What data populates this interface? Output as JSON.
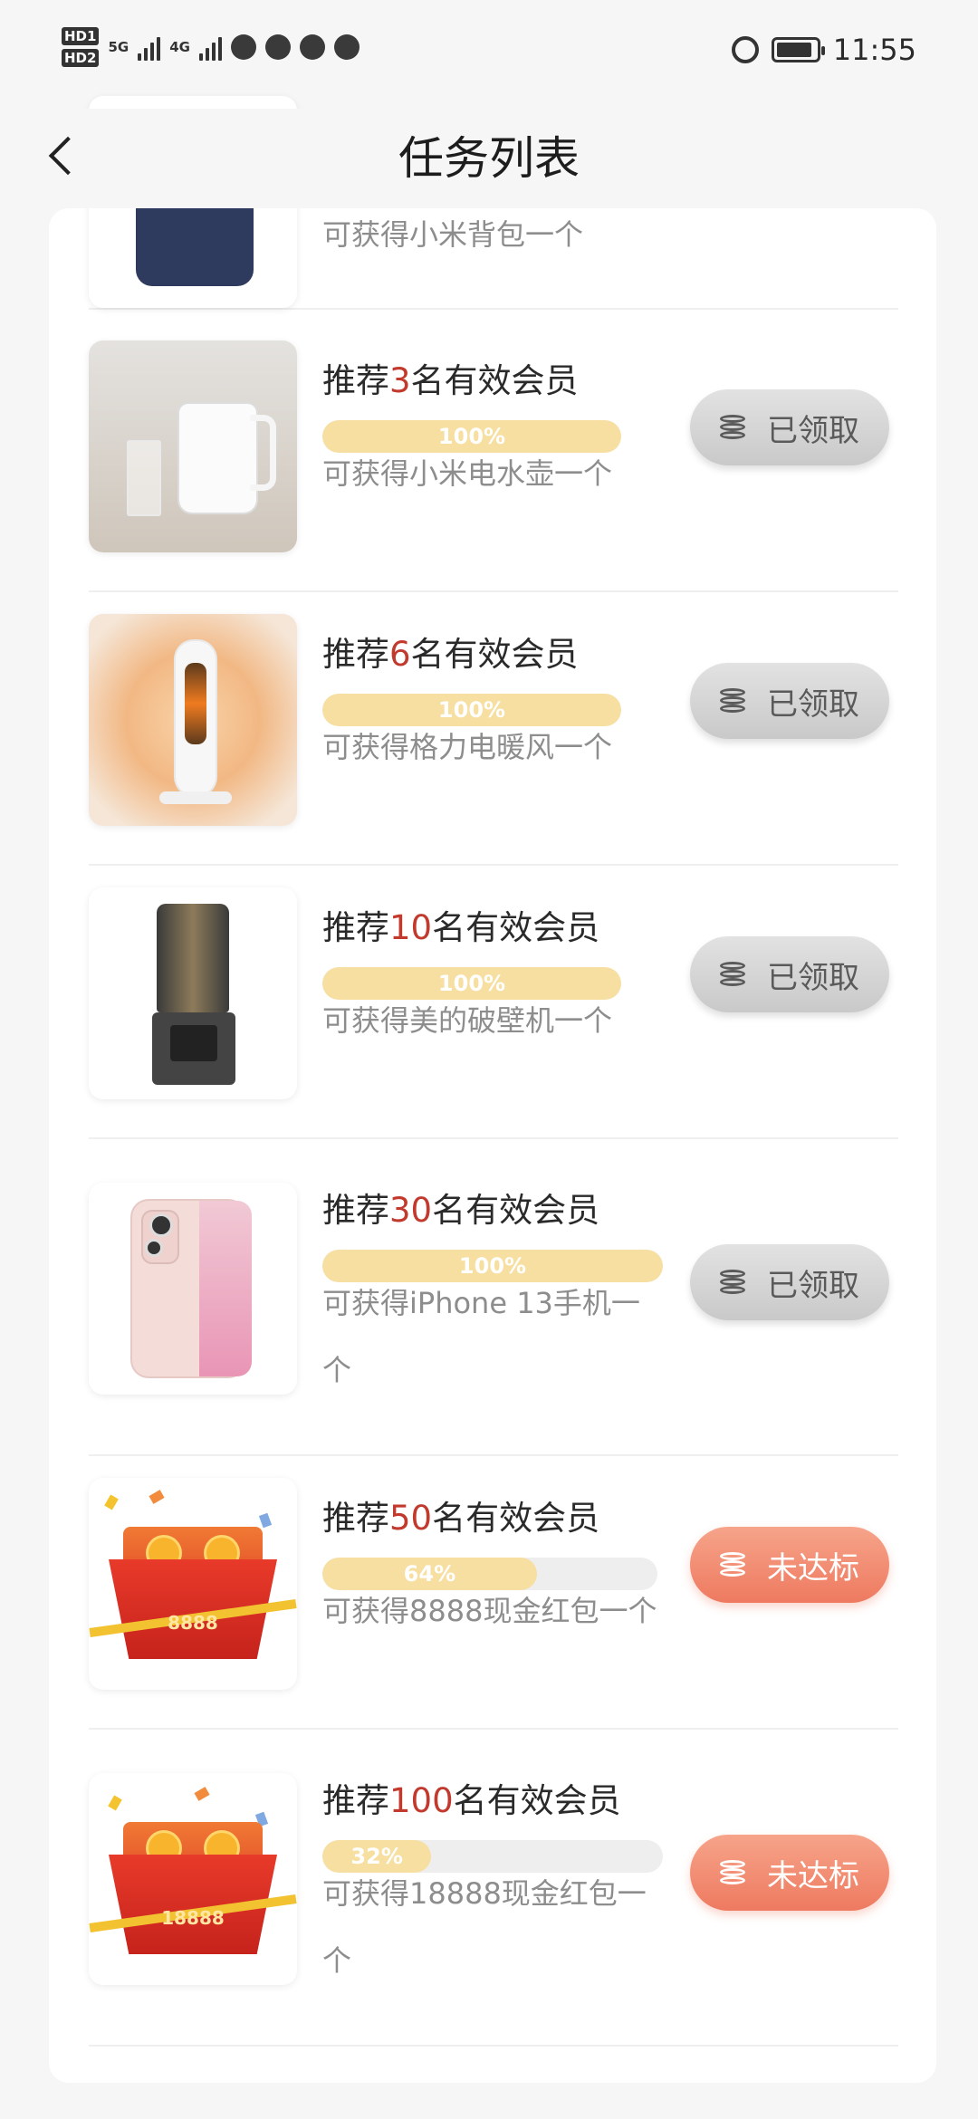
{
  "status_bar": {
    "hd_labels": [
      "HD1",
      "HD2"
    ],
    "network_1": "5G",
    "network_2": "4G",
    "time": "11:55"
  },
  "nav": {
    "title": "任务列表",
    "back_icon": "chevron-left-icon"
  },
  "tasks": [
    {
      "title_prefix": "",
      "count": "",
      "title_suffix": "",
      "progress": null,
      "progress_label": "",
      "reward": "可获得小米背包一个",
      "button": "",
      "image": "backpack"
    },
    {
      "title_prefix": "推荐",
      "count": "3",
      "title_suffix": "名有效会员",
      "progress": 1.0,
      "progress_label": "100%",
      "reward": "可获得小米电水壶一个",
      "button": "已领取",
      "image": "electric-kettle"
    },
    {
      "title_prefix": "推荐",
      "count": "6",
      "title_suffix": "名有效会员",
      "progress": 1.0,
      "progress_label": "100%",
      "reward": "可获得格力电暖风一个",
      "button": "已领取",
      "image": "space-heater"
    },
    {
      "title_prefix": "推荐",
      "count": "10",
      "title_suffix": "名有效会员",
      "progress": 1.0,
      "progress_label": "100%",
      "reward": "可获得美的破壁机一个",
      "button": "已领取",
      "image": "blender"
    },
    {
      "title_prefix": "推荐",
      "count": "30",
      "title_suffix": "名有效会员",
      "progress": 1.0,
      "progress_label": "100%",
      "reward": "可获得iPhone 13手机一个",
      "button": "已领取",
      "image": "iphone"
    },
    {
      "title_prefix": "推荐",
      "count": "50",
      "title_suffix": "名有效会员",
      "progress": 0.64,
      "progress_label": "64%",
      "reward": "可获得8888现金红包一个",
      "button": "未达标",
      "image": "red-envelope",
      "image_text": "8888"
    },
    {
      "title_prefix": "推荐",
      "count": "100",
      "title_suffix": "名有效会员",
      "progress": 0.32,
      "progress_label": "32%",
      "reward": "可获得18888现金红包一个",
      "button": "未达标",
      "image": "red-envelope",
      "image_text": "18888"
    }
  ],
  "colors": {
    "accent_red": "#c23a2e",
    "progress_fill": "#f6dfa0",
    "button_claimed": "#d6d6d6",
    "button_unmet": "#ee7a60"
  }
}
